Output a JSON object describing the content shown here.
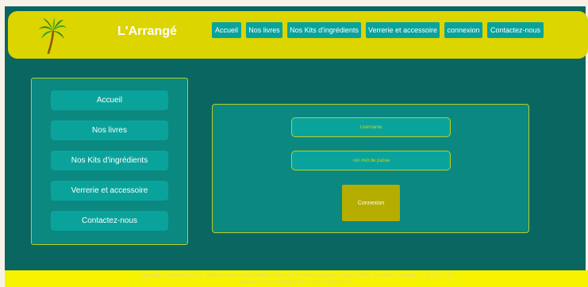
{
  "header": {
    "brand": "L'Arrangé",
    "logo_icon": "palm-tree-icon",
    "nav": [
      {
        "label": "Accueil"
      },
      {
        "label": "Nos livres"
      },
      {
        "label": "Nos Kits d'ingrédients"
      },
      {
        "label": "Verrerie et accessoire"
      },
      {
        "label": "connexion"
      },
      {
        "label": "Contactez-nous"
      }
    ]
  },
  "sidebar": {
    "items": [
      {
        "label": "Accueil"
      },
      {
        "label": "Nos livres"
      },
      {
        "label": "Nos Kits d'ingrédients"
      },
      {
        "label": "Verrerie et accessoire"
      },
      {
        "label": "Contactez-nous"
      }
    ]
  },
  "login": {
    "username_placeholder": "Username",
    "password_placeholder": "Ton mot de passe",
    "submit_label": "Connexion"
  },
  "footer": {
    "line1": "Copyright L'Arrangé-2021- William Kaczmarek/Julien Richard 14 avenue du parc Cergy 95000, Société l'Arrangé 01 22 33 44 55",
    "line2": "william.kaczmarek@eisti.fr richardjul@eisti.eu"
  },
  "colors": {
    "header_bg": "#dcd500",
    "main_bg": "#0a6660",
    "panel_bg": "#0b8880",
    "button_bg": "#0aa39b",
    "accent_border": "#b7cf2a",
    "submit_bg": "#b5ad00",
    "footer_bg": "#f7f300"
  }
}
